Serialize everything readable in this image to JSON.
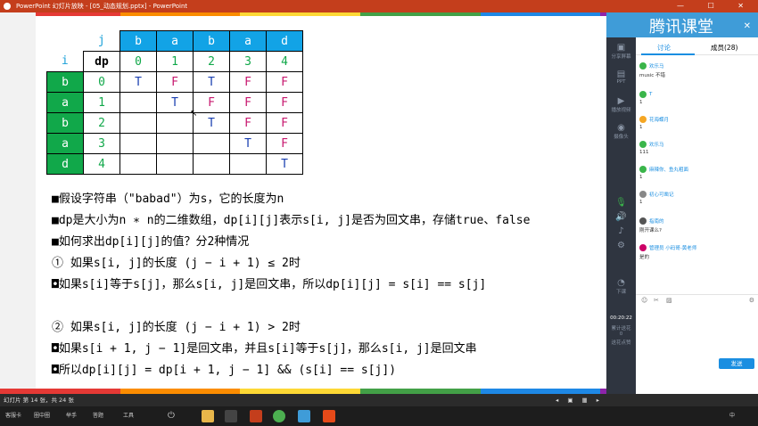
{
  "window": {
    "title": "PowerPoint 幻灯片放映 - [05_动态规划.pptx] - PowerPoint"
  },
  "slide": {
    "table": {
      "j_label": "j",
      "i_label": "i",
      "dp_label": "dp",
      "chars": [
        "b",
        "a",
        "b",
        "a",
        "d"
      ],
      "col_index": [
        "0",
        "1",
        "2",
        "3",
        "4"
      ],
      "rows": [
        {
          "ch": "b",
          "idx": "0",
          "cells": [
            "T",
            "F",
            "T",
            "F",
            "F"
          ]
        },
        {
          "ch": "a",
          "idx": "1",
          "cells": [
            "",
            "T",
            "F",
            "F",
            "F"
          ]
        },
        {
          "ch": "b",
          "idx": "2",
          "cells": [
            "",
            "",
            "T",
            "F",
            "F"
          ]
        },
        {
          "ch": "a",
          "idx": "3",
          "cells": [
            "",
            "",
            "",
            "T",
            "F"
          ]
        },
        {
          "ch": "d",
          "idx": "4",
          "cells": [
            "",
            "",
            "",
            "",
            "T"
          ]
        }
      ]
    },
    "lines": [
      "■假设字符串（\"babad\"）为s，它的长度为n",
      "■dp是大小为n ∗ n的二维数组，dp[i][j]表示s[i, j]是否为回文串，存储true、false",
      "■如何求出dp[i][j]的值？分2种情况",
      "① 如果s[i, j]的长度 (j − i + 1) ≤ 2时",
      "◘如果s[i]等于s[j]，那么s[i, j]是回文串，所以dp[i][j] = s[i] == s[j]",
      "",
      "② 如果s[i, j]的长度 (j − i + 1) > 2时",
      "◘如果s[i + 1, j − 1]是回文串，并且s[i]等于s[j]，那么s[i, j]是回文串",
      "◘所以dp[i][j] = dp[i + 1, j − 1] && (s[i] == s[j])"
    ]
  },
  "statusbar": {
    "left": "幻灯片 第 14 张，共 24 张"
  },
  "taskbar": {
    "items": [
      "客服卡",
      "圈中圈",
      "举手",
      "答题",
      "工具"
    ],
    "ime": "中"
  },
  "panel": {
    "brand": "腾讯课堂",
    "rail": [
      "分享屏幕",
      "PPT",
      "播放视频",
      "摄像头",
      "下课"
    ],
    "time": "00:20:22",
    "stats": [
      "累计送花",
      "0",
      "送花点赞"
    ],
    "tabs": {
      "discuss": "讨论",
      "members": "成员(28)"
    },
    "messages": [
      {
        "name": "欢乐马",
        "text": "music 不错"
      },
      {
        "name": "T",
        "text": "1"
      },
      {
        "name": "花海蝶月",
        "text": "1"
      },
      {
        "name": "欢乐马",
        "text": "111"
      },
      {
        "name": "麻辣你、鱼丸粗面",
        "text": "1"
      },
      {
        "name": "初心可凿记",
        "text": "1"
      },
      {
        "name": "指南的",
        "text": "刚开课么?"
      },
      {
        "name": "管理员  小码哥-黄老师",
        "text": "是的"
      }
    ],
    "send": "发送"
  },
  "colors": {
    "accent": "#1a8ee1",
    "header_blue": "#12a3e6",
    "row_green": "#11a84a",
    "true_blue": "#1a3fb0",
    "false_pink": "#c7186f"
  }
}
